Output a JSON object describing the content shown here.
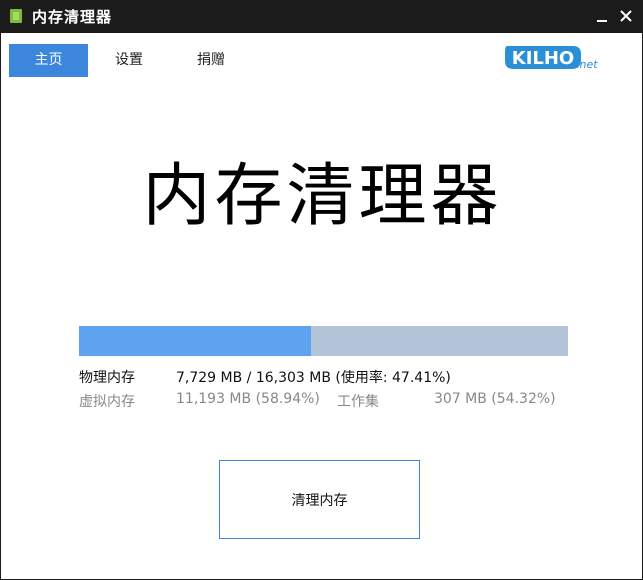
{
  "window": {
    "title": "内存清理器"
  },
  "tabs": [
    {
      "label": "主页",
      "active": true
    },
    {
      "label": "设置",
      "active": false
    },
    {
      "label": "捐赠",
      "active": false
    }
  ],
  "logo": {
    "main": "KILHO",
    "suffix": ".net",
    "color": "#2b8fd8"
  },
  "main": {
    "heading": "内存清理器"
  },
  "memory": {
    "usage_fraction": 0.4741,
    "physical_label": "物理内存",
    "physical_value": "7,729 MB / 16,303 MB (使用率: 47.41%)",
    "virtual_label": "虚拟内存",
    "virtual_value": "11,193 MB (58.94%)",
    "working_set_label": "工作集",
    "working_set_value": "307 MB (54.32%)"
  },
  "actions": {
    "clean_label": "清理内存"
  },
  "colors": {
    "accent": "#3c87db",
    "progress_fill": "#5ea3ef",
    "progress_track": "#b4c4d8",
    "titlebar": "#1b1b1b"
  }
}
